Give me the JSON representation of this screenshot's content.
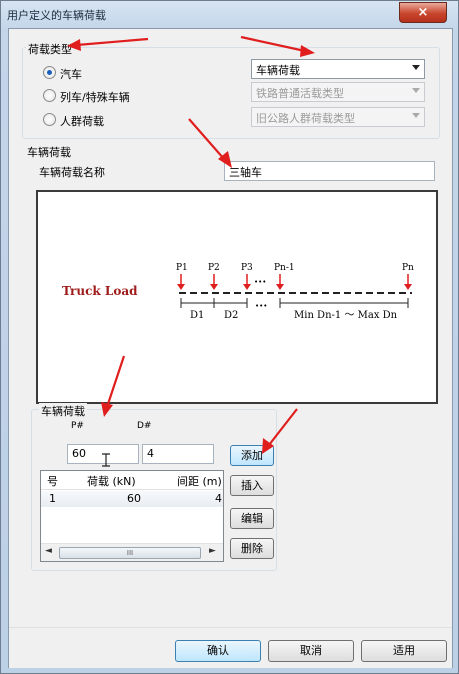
{
  "window": {
    "title": "用户定义的车辆荷载",
    "close": "×"
  },
  "load_type": {
    "group_title": "荷载类型",
    "options": [
      {
        "label": "汽车",
        "selected": true
      },
      {
        "label": "列车/特殊车辆",
        "selected": false
      },
      {
        "label": "人群荷载",
        "selected": false
      }
    ],
    "combos": [
      {
        "value": "车辆荷载",
        "enabled": true
      },
      {
        "value": "铁路普通活载类型",
        "enabled": false
      },
      {
        "value": "旧公路人群荷载类型",
        "enabled": false
      }
    ]
  },
  "vehicle": {
    "group_title": "车辆荷载",
    "name_label": "车辆荷载名称",
    "name_value": "三轴车"
  },
  "diagram": {
    "truck_label": "Truck Load",
    "p_labels": [
      "P1",
      "P2",
      "P3",
      "•••",
      "Pn-1",
      "Pn"
    ],
    "d_labels": [
      "D1",
      "D2",
      "•••",
      "Min Dn-1 ～ Max Dn"
    ]
  },
  "axles": {
    "group_title": "车辆荷载",
    "p_header": "P#",
    "d_header": "D#",
    "p_value": "60",
    "d_value": "4",
    "columns": [
      "号",
      "荷载 (kN)",
      "间距 (m)"
    ],
    "rows": [
      {
        "no": "1",
        "load": "60",
        "spacing": "4"
      }
    ],
    "scroll_left": "◄",
    "scroll_right": "►",
    "scroll_grip": "III"
  },
  "side_buttons": {
    "add": "添加",
    "insert": "插入",
    "edit": "编辑",
    "delete": "删除"
  },
  "footer": {
    "ok": "确认",
    "cancel": "取消",
    "apply": "适用"
  },
  "colors": {
    "annotation": "#e01e1e",
    "diagram_red": "#c0101a",
    "default_button": "#3c7fb1"
  }
}
